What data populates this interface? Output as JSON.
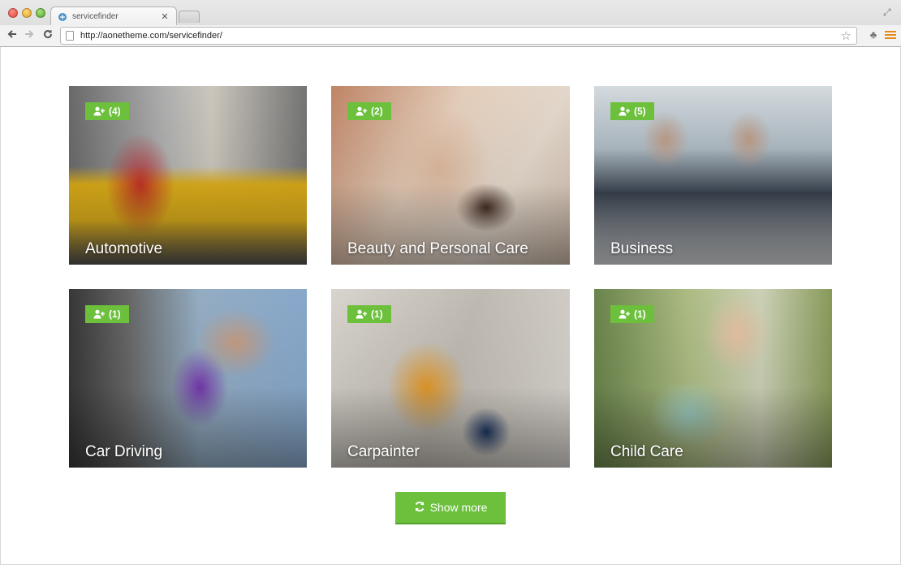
{
  "browser": {
    "tab_title": "servicefinder",
    "url": "http://aonetheme.com/servicefinder/"
  },
  "categories": [
    {
      "name": "Automotive",
      "count": "(4)",
      "bg": "bg-auto"
    },
    {
      "name": "Beauty and Personal Care",
      "count": "(2)",
      "bg": "bg-beauty"
    },
    {
      "name": "Business",
      "count": "(5)",
      "bg": "bg-business"
    },
    {
      "name": "Car Driving",
      "count": "(1)",
      "bg": "bg-driving"
    },
    {
      "name": "Carpainter",
      "count": "(1)",
      "bg": "bg-carpainter"
    },
    {
      "name": "Child Care",
      "count": "(1)",
      "bg": "bg-child"
    }
  ],
  "show_more_label": "Show more",
  "colors": {
    "accent": "#6cc03c"
  },
  "icons": {
    "badge": "user-plus-icon",
    "button": "refresh-icon"
  }
}
